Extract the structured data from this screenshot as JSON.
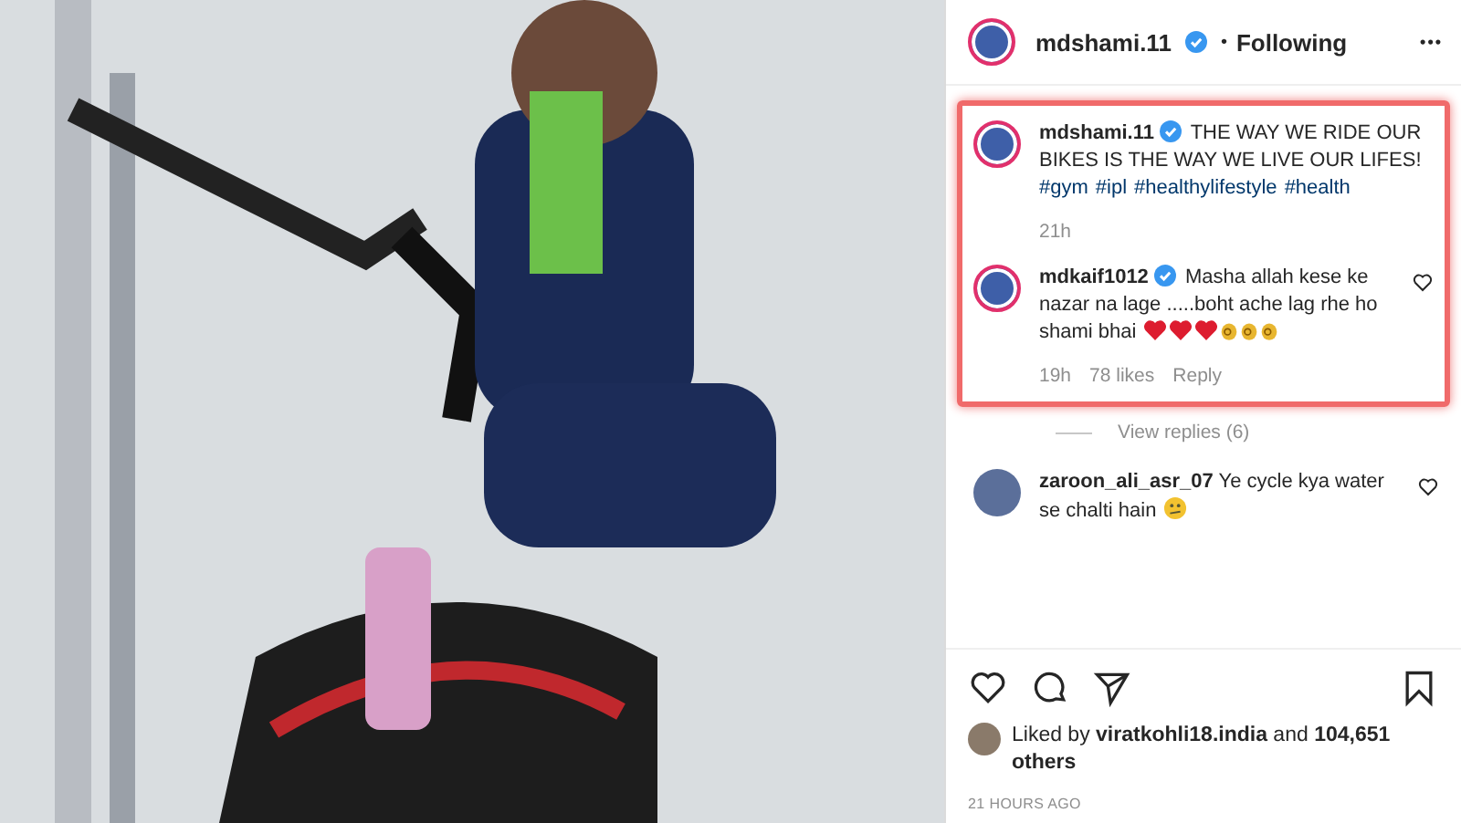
{
  "post": {
    "author": "mdshami.11",
    "verified": true,
    "follow_status": "Following",
    "separator": "•",
    "more": "•••"
  },
  "highlight": {
    "on": true,
    "caption": {
      "author": "mdshami.11",
      "verified": true,
      "text": "THE WAY WE RIDE OUR BIKES IS THE WAY WE LIVE OUR LIFES!",
      "hashtags": [
        "#gym",
        "#ipl",
        "#healthylifestyle",
        "#health"
      ],
      "time": "21h"
    },
    "comments": [
      {
        "author": "mdkaif1012",
        "verified": true,
        "text": "Masha allah kese ke nazar na lage .....boht ache lag rhe ho shami bhai",
        "emoji": [
          {
            "kind": "heart"
          },
          {
            "kind": "heart"
          },
          {
            "kind": "heart"
          },
          {
            "kind": "ok_hand"
          },
          {
            "kind": "ok_hand"
          },
          {
            "kind": "ok_hand"
          }
        ],
        "time": "19h",
        "likes": "78 likes",
        "reply": "Reply"
      }
    ]
  },
  "view_replies": "View replies (6)",
  "comments": [
    {
      "author": "zaroon_ali_asr_07",
      "text": "Ye cycle kya water se chalti hain",
      "emoji": [
        {
          "kind": "confused"
        }
      ]
    }
  ],
  "likes": {
    "prefix": "Liked by",
    "user": "viratkohli18.india",
    "suffix": "and",
    "others": "104,651 others"
  },
  "timestamp": "21 HOURS AGO"
}
